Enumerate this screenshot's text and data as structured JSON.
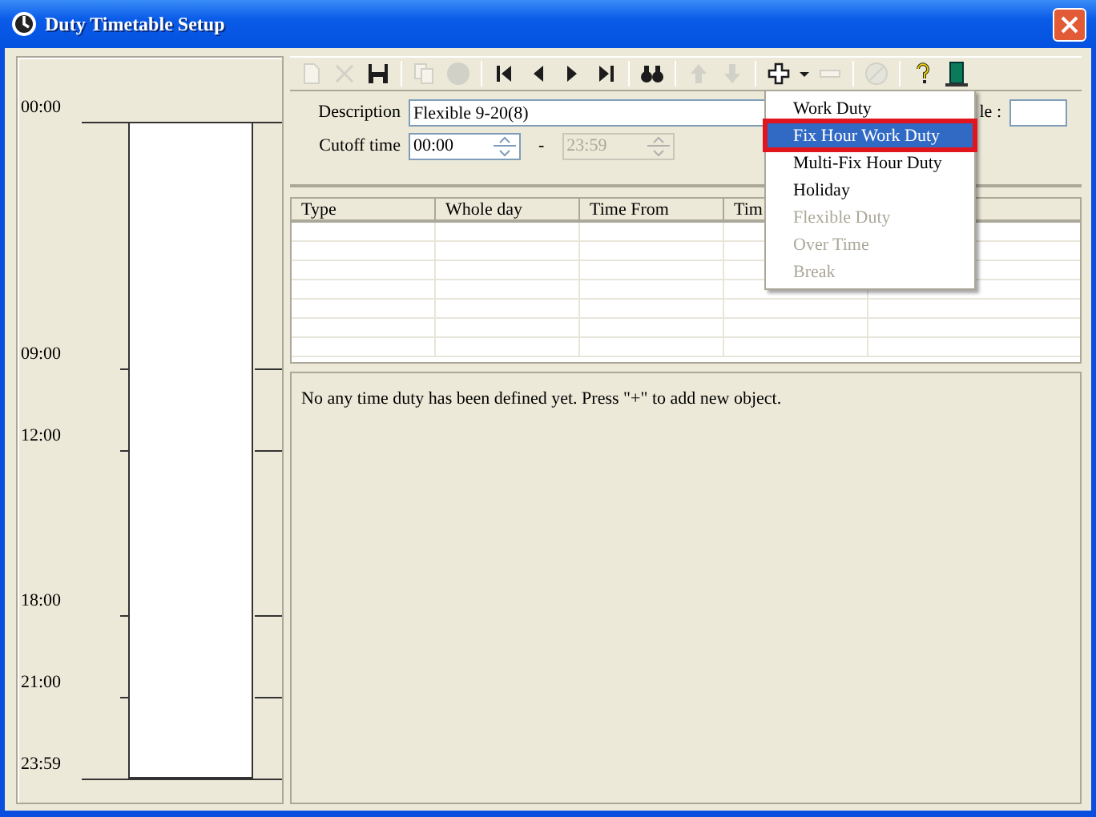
{
  "window": {
    "title": "Duty Timetable Setup"
  },
  "timeline": {
    "marks": [
      {
        "label": "00:00",
        "kind": "edge"
      },
      {
        "label": "09:00",
        "kind": "tick"
      },
      {
        "label": "12:00",
        "kind": "tick"
      },
      {
        "label": "18:00",
        "kind": "tick"
      },
      {
        "label": "21:00",
        "kind": "tick"
      },
      {
        "label": "23:59",
        "kind": "edge"
      }
    ]
  },
  "toolbar": [
    {
      "kind": "new",
      "disabled": true
    },
    {
      "kind": "delete",
      "disabled": true
    },
    {
      "kind": "save",
      "disabled": false
    },
    {
      "kind": "sep"
    },
    {
      "kind": "copy",
      "disabled": true
    },
    {
      "kind": "record",
      "disabled": true
    },
    {
      "kind": "sep"
    },
    {
      "kind": "first",
      "disabled": false
    },
    {
      "kind": "prev",
      "disabled": false
    },
    {
      "kind": "next",
      "disabled": false
    },
    {
      "kind": "last",
      "disabled": false
    },
    {
      "kind": "sep"
    },
    {
      "kind": "find",
      "disabled": false
    },
    {
      "kind": "sep"
    },
    {
      "kind": "up",
      "disabled": true
    },
    {
      "kind": "down",
      "disabled": true
    },
    {
      "kind": "sep"
    },
    {
      "kind": "add",
      "disabled": false
    },
    {
      "kind": "dropdown",
      "disabled": false
    },
    {
      "kind": "remove",
      "disabled": true
    },
    {
      "kind": "sep"
    },
    {
      "kind": "cancel",
      "disabled": true
    },
    {
      "kind": "sep"
    },
    {
      "kind": "help",
      "disabled": false
    },
    {
      "kind": "exit",
      "disabled": false
    }
  ],
  "form": {
    "description_label": "Description",
    "description": "Flexible 9-20(8)",
    "side_label": "le :",
    "cutoff_label": "Cutoff time",
    "cutoff_from": "00:00",
    "separator": "-",
    "cutoff_to": "23:59",
    "cutoff_to_disabled": true
  },
  "table": {
    "columns": [
      "Type",
      "Whole day",
      "Time From",
      "Tim"
    ]
  },
  "message": "No any time duty has been defined yet. Press \"+\" to add new object.",
  "menu": {
    "items": [
      {
        "label": "Work Duty",
        "selected": false,
        "disabled": false
      },
      {
        "label": "Fix Hour Work Duty",
        "selected": true,
        "disabled": false
      },
      {
        "label": "Multi-Fix Hour Duty",
        "selected": false,
        "disabled": false
      },
      {
        "label": "Holiday",
        "selected": false,
        "disabled": false
      },
      {
        "label": "Flexible Duty",
        "selected": false,
        "disabled": true
      },
      {
        "label": "Over Time",
        "selected": false,
        "disabled": true
      },
      {
        "label": "Break",
        "selected": false,
        "disabled": true
      }
    ]
  }
}
